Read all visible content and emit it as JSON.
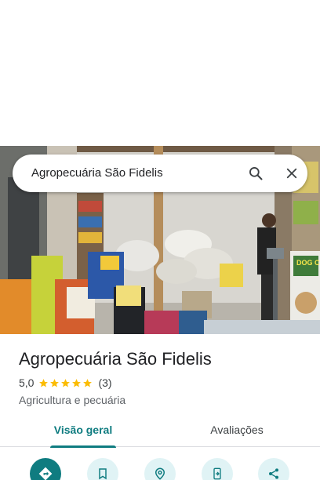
{
  "search": {
    "query": "Agropecuária São Fidelis"
  },
  "place": {
    "name": "Agropecuária São Fidelis",
    "rating": "5,0",
    "stars": 5,
    "review_count": "(3)",
    "category": "Agricultura e pecuária"
  },
  "tabs": [
    {
      "label": "Visão geral",
      "active": true
    },
    {
      "label": "Avaliações",
      "active": false
    }
  ],
  "actions": [
    {
      "icon": "directions-icon"
    },
    {
      "icon": "bookmark-icon"
    },
    {
      "icon": "nearby-icon"
    },
    {
      "icon": "send-to-phone-icon"
    },
    {
      "icon": "share-icon"
    }
  ],
  "photo": {
    "signs": [
      "DOG CHOW"
    ]
  },
  "colors": {
    "accent": "#0f7c80",
    "action_bg": "#e0f3f5",
    "star": "#fbbc04"
  }
}
